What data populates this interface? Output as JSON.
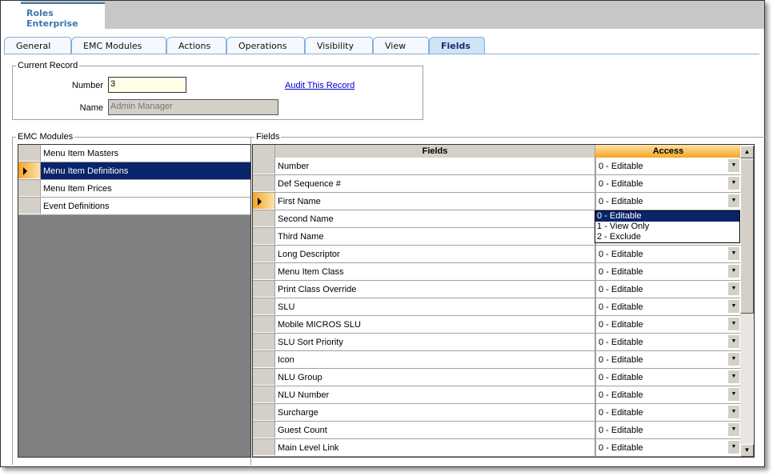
{
  "title": {
    "line1": "Roles",
    "line2": "Enterprise"
  },
  "tabs": [
    "General",
    "EMC Modules",
    "Actions",
    "Operations",
    "Visibility",
    "View",
    "Fields"
  ],
  "current_record": {
    "legend": "Current Record",
    "number_label": "Number",
    "number_value": "3",
    "name_label": "Name",
    "name_value": "Admin Manager",
    "audit_link": "Audit This Record"
  },
  "emc_modules": {
    "legend": "EMC Modules",
    "items": [
      "Menu Item Masters",
      "Menu Item Definitions",
      "Menu Item Prices",
      "Event Definitions"
    ],
    "selected": 1
  },
  "fields": {
    "legend": "Fields",
    "col_fields": "Fields",
    "col_access": "Access",
    "rows": [
      [
        "Number",
        "0 - Editable"
      ],
      [
        "Def Sequence #",
        "0 - Editable"
      ],
      [
        "First Name",
        "0 - Editable"
      ],
      [
        "Second Name",
        ""
      ],
      [
        "Third Name",
        ""
      ],
      [
        "Long Descriptor",
        "0 - Editable"
      ],
      [
        "Menu Item Class",
        "0 - Editable"
      ],
      [
        "Print Class Override",
        "0 - Editable"
      ],
      [
        "SLU",
        "0 - Editable"
      ],
      [
        "Mobile MICROS SLU",
        "0 - Editable"
      ],
      [
        "SLU Sort Priority",
        "0 - Editable"
      ],
      [
        "Icon",
        "0 - Editable"
      ],
      [
        "NLU Group",
        "0 - Editable"
      ],
      [
        "NLU Number",
        "0 - Editable"
      ],
      [
        "Surcharge",
        "0 - Editable"
      ],
      [
        "Guest Count",
        "0 - Editable"
      ],
      [
        "Main Level Link",
        "0 - Editable"
      ]
    ],
    "current_row": 2,
    "dropdown_options": [
      "0 - Editable",
      "1 - View Only",
      "2 - Exclude"
    ]
  },
  "colors": {
    "accent": "#f6a522",
    "selection": "#0a246a",
    "tab_border": "#7fb0e0"
  }
}
